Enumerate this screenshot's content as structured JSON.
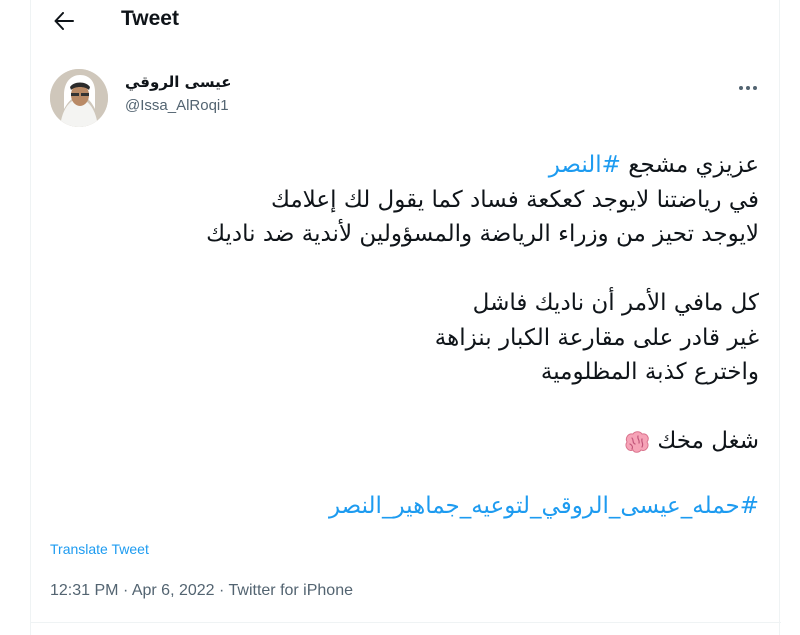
{
  "header": {
    "title": "Tweet",
    "back_icon": "arrow-left-icon"
  },
  "user": {
    "display_name": "عيسى الروقي",
    "handle": "@Issa_AlRoqi1",
    "more_icon": "more-dots-icon"
  },
  "tweet": {
    "line1_prefix": "عزيزي مشجع ",
    "line1_hashtag": "#النصر",
    "line2": "في رياضتنا لايوجد كعكعة فساد كما يقول لك إعلامك",
    "line3": "لايوجد تحيز من وزراء الرياضة والمسؤولين لأندية ضد ناديك",
    "line4": "كل مافي الأمر أن ناديك فاشل",
    "line5": "غير قادر على مقارعة الكبار بنزاهة",
    "line6": "واخترع كذبة المظلومية",
    "line7": "شغل مخك",
    "emoji_icon": "brain-emoji-icon",
    "final_hashtag": "#حمله_عيسى_الروقي_لتوعيه_جماهير_النصر"
  },
  "translate_label": "Translate Tweet",
  "meta": {
    "time": "12:31 PM",
    "date": "Apr 6, 2022",
    "source": "Twitter for iPhone",
    "separator": "·"
  },
  "colors": {
    "link": "#1d9bf0",
    "text": "#0f1419",
    "secondary": "#536471"
  }
}
